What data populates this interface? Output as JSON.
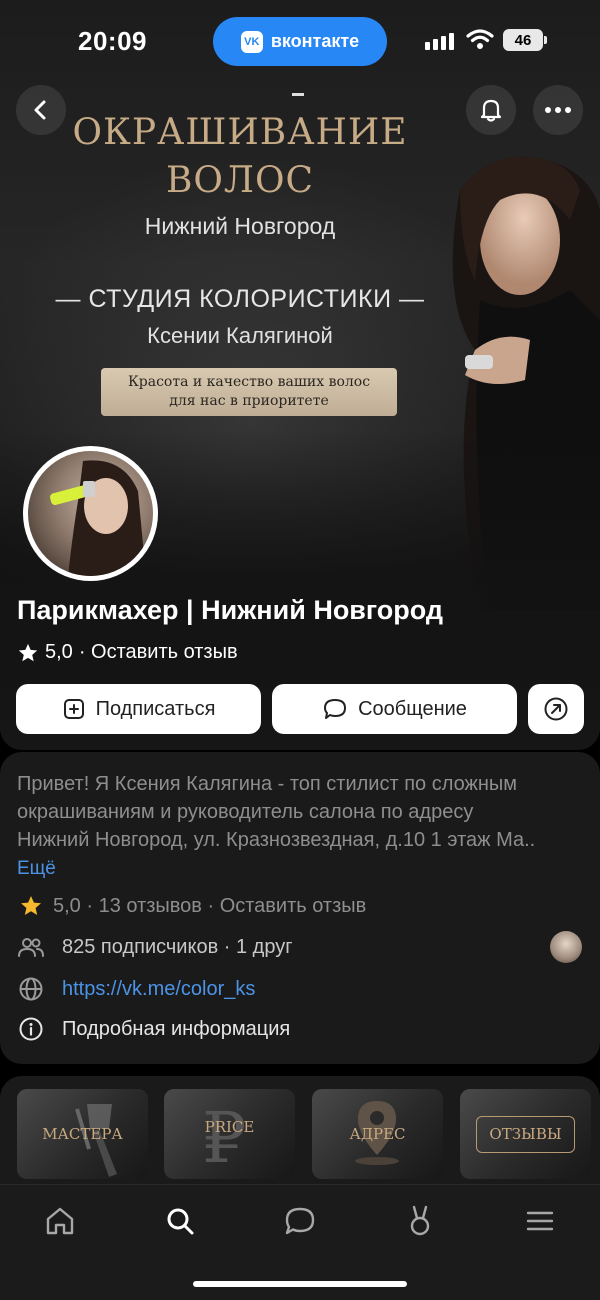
{
  "status_bar": {
    "time": "20:09",
    "app_pill": "вконтакте",
    "battery": "46"
  },
  "cover": {
    "title_line1": "ОКРАШИВАНИЕ",
    "title_line2": "ВОЛОС",
    "city": "Нижний Новгород",
    "studio": "— СТУДИЯ КОЛОРИСТИКИ —",
    "master": "Ксении Калягиной",
    "slogan_line1": "Красота и качество ваших волос",
    "slogan_line2": "для нас в приоритете"
  },
  "profile": {
    "name": "Парикмахер | Нижний Новгород",
    "rating": "5,0",
    "leave_review": "· Оставить отзыв"
  },
  "actions": {
    "subscribe": "Подписаться",
    "message": "Сообщение"
  },
  "info": {
    "bio_line1": "Привет! Я Ксения Калягина - топ стилист по сложным",
    "bio_line2": "окрашиваниям и руководитель салона по адресу",
    "bio_line3": "Нижний Новгород, ул. Кразнозвездная, д.10  1 этаж Ма..",
    "more": "Ещё",
    "rating_line": "5,0 · 13 отзывов · Оставить отзыв",
    "subscribers": "825 подписчиков · 1 друг",
    "link": "https://vk.me/color_ks",
    "details": "Подробная информация"
  },
  "menu_tiles": [
    "МАСТЕРА",
    "PRICE",
    "АДРЕС",
    "ОТЗЫВЫ"
  ],
  "colors": {
    "accent_blue": "#2787f5",
    "link_blue": "#4b93e6",
    "gold": "#c7ab86",
    "star_gold": "#f5b82e"
  },
  "tabbar": [
    "home-icon",
    "search-icon",
    "messages-icon",
    "clips-icon",
    "menu-icon"
  ]
}
